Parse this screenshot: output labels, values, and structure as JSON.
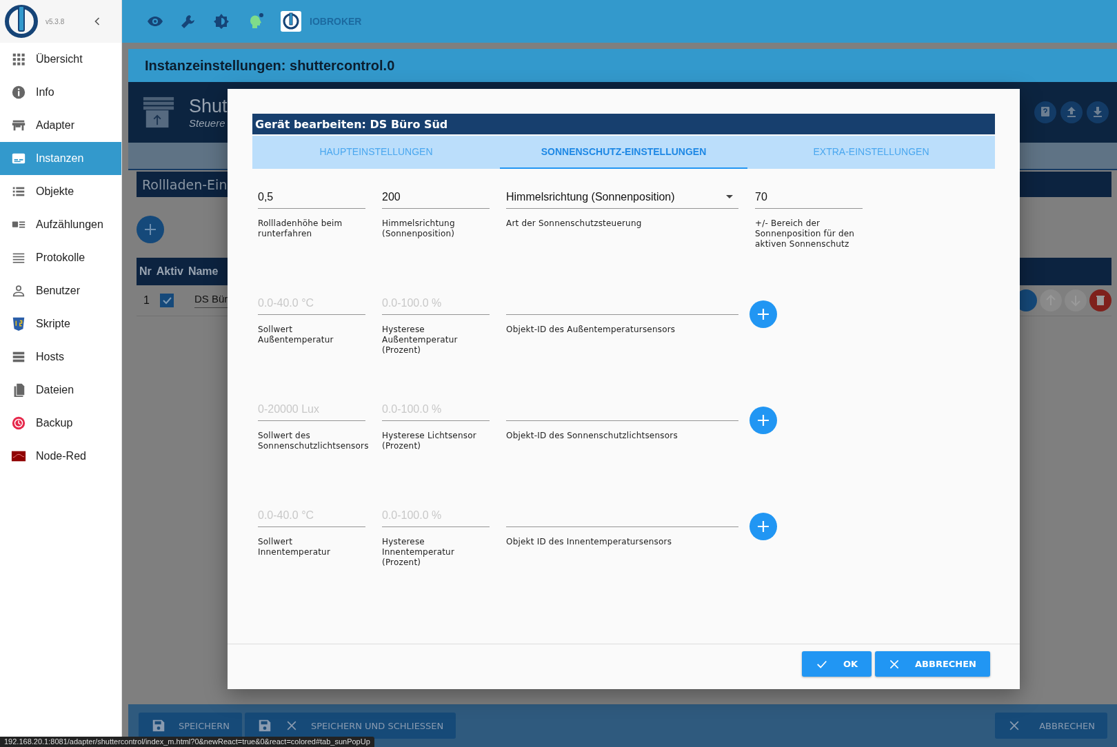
{
  "sidebar": {
    "version": "v5.3.8",
    "items": [
      {
        "label": "Übersicht",
        "selected": false
      },
      {
        "label": "Info",
        "selected": false
      },
      {
        "label": "Adapter",
        "selected": false
      },
      {
        "label": "Instanzen",
        "selected": true
      },
      {
        "label": "Objekte",
        "selected": false
      },
      {
        "label": "Aufzählungen",
        "selected": false
      },
      {
        "label": "Protokolle",
        "selected": false
      },
      {
        "label": "Benutzer",
        "selected": false
      },
      {
        "label": "Skripte",
        "selected": false
      },
      {
        "label": "Hosts",
        "selected": false
      },
      {
        "label": "Dateien",
        "selected": false
      },
      {
        "label": "Backup",
        "selected": false
      },
      {
        "label": "Node-Red",
        "selected": false
      }
    ]
  },
  "top_bar": {
    "brand": "IOBROKER"
  },
  "instance_title": "Instanzeinstellungen: shuttercontrol.0",
  "background": {
    "adapter_title": "Shut",
    "adapter_subtitle": "Steuere",
    "section_title": "Rollladen-Ein",
    "table": {
      "columns": [
        "Nr",
        "Aktiv",
        "Name"
      ],
      "rows": [
        {
          "nr": "1",
          "active": true,
          "name": "DS Bür"
        }
      ]
    },
    "footer_buttons": [
      {
        "label": "SPEICHERN",
        "kind": "save"
      },
      {
        "label": "SPEICHERN UND SCHLIESSEN",
        "kind": "save_close"
      },
      {
        "label": "ABBRECHEN",
        "kind": "cancel"
      }
    ]
  },
  "dialog": {
    "title": "Gerät bearbeiten: DS Büro Süd",
    "tabs": [
      {
        "label": "HAUPTEINSTELLUNGEN",
        "selected": false
      },
      {
        "label": "SONNENSCHUTZ-EINSTELLUNGEN",
        "selected": true
      },
      {
        "label": "EXTRA-EINSTELLUNGEN",
        "selected": false
      }
    ],
    "rows": [
      [
        {
          "kind": "text",
          "value": "0,5",
          "label": "Rollladenhöhe beim runterfahren"
        },
        {
          "kind": "text",
          "value": "200",
          "label": "Himmelsrichtung (Sonnenposition)"
        },
        {
          "kind": "select",
          "value": "Himmelsrichtung (Sonnenposition)",
          "label": "Art der Sonnenschutzsteuerung"
        },
        {
          "kind": "text",
          "value": "70",
          "label": "+/- Bereich der Sonnenposition für den aktiven Sonnenschutz"
        }
      ],
      [
        {
          "kind": "text",
          "placeholder": "0.0-40.0 °C",
          "label": "Sollwert Außentemperatur"
        },
        {
          "kind": "text",
          "placeholder": "0.0-100.0 %",
          "label": "Hysterese Außentemperatur (Prozent)"
        },
        {
          "kind": "object_id",
          "label": "Objekt-ID des Außentemperatursensors"
        }
      ],
      [
        {
          "kind": "text",
          "placeholder": "0-20000 Lux",
          "label": "Sollwert des Sonnenschutzlichtsensors"
        },
        {
          "kind": "text",
          "placeholder": "0.0-100.0 %",
          "label": "Hysterese Lichtsensor (Prozent)"
        },
        {
          "kind": "object_id",
          "label": "Objekt-ID des Sonnenschutzlichtsensors"
        }
      ],
      [
        {
          "kind": "text",
          "placeholder": "0.0-40.0 °C",
          "label": "Sollwert Innentemperatur"
        },
        {
          "kind": "text",
          "placeholder": "0.0-100.0 %",
          "label": "Hysterese Innentemperatur (Prozent)"
        },
        {
          "kind": "object_id",
          "label": "Objekt ID des Innentemperatursensors"
        }
      ]
    ],
    "buttons": [
      {
        "label": "OK",
        "kind": "ok"
      },
      {
        "label": "ABBRECHEN",
        "kind": "cancel"
      }
    ]
  },
  "status_url": "192.168.20.1:8081/adapter/shuttercontrol/index_m.html?0&newReact=true&0&react=colored#tab_sunPopUp"
}
